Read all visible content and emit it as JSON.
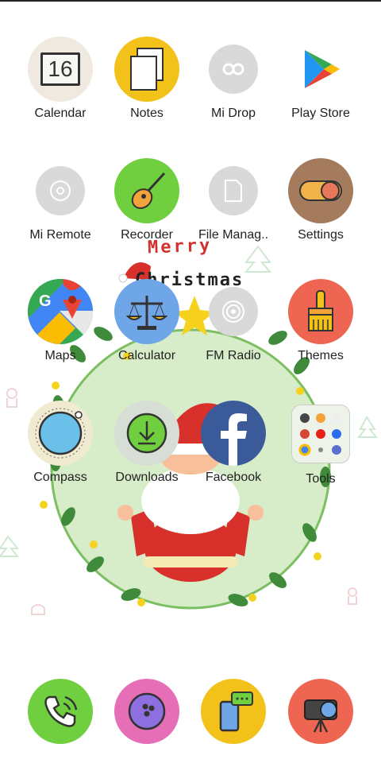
{
  "wallpaper": {
    "line1": "Merry",
    "line2": "Christmas"
  },
  "apps": [
    {
      "id": "calendar",
      "label": "Calendar",
      "badge": "16"
    },
    {
      "id": "notes",
      "label": "Notes"
    },
    {
      "id": "midrop",
      "label": "Mi Drop"
    },
    {
      "id": "playstore",
      "label": "Play Store"
    },
    {
      "id": "miremote",
      "label": "Mi Remote"
    },
    {
      "id": "recorder",
      "label": "Recorder"
    },
    {
      "id": "filemanager",
      "label": "File Manag.."
    },
    {
      "id": "settings",
      "label": "Settings"
    },
    {
      "id": "maps",
      "label": "Maps"
    },
    {
      "id": "calculator",
      "label": "Calculator"
    },
    {
      "id": "fmradio",
      "label": "FM Radio"
    },
    {
      "id": "themes",
      "label": "Themes"
    },
    {
      "id": "compass",
      "label": "Compass"
    },
    {
      "id": "downloads",
      "label": "Downloads"
    },
    {
      "id": "facebook",
      "label": "Facebook"
    },
    {
      "id": "tools",
      "label": "Tools"
    }
  ],
  "dock": [
    {
      "id": "phone",
      "icon": "phone-icon"
    },
    {
      "id": "browser",
      "icon": "bowling-ball-icon"
    },
    {
      "id": "messaging",
      "icon": "chat-phone-icon"
    },
    {
      "id": "camera",
      "icon": "camera-icon"
    }
  ]
}
